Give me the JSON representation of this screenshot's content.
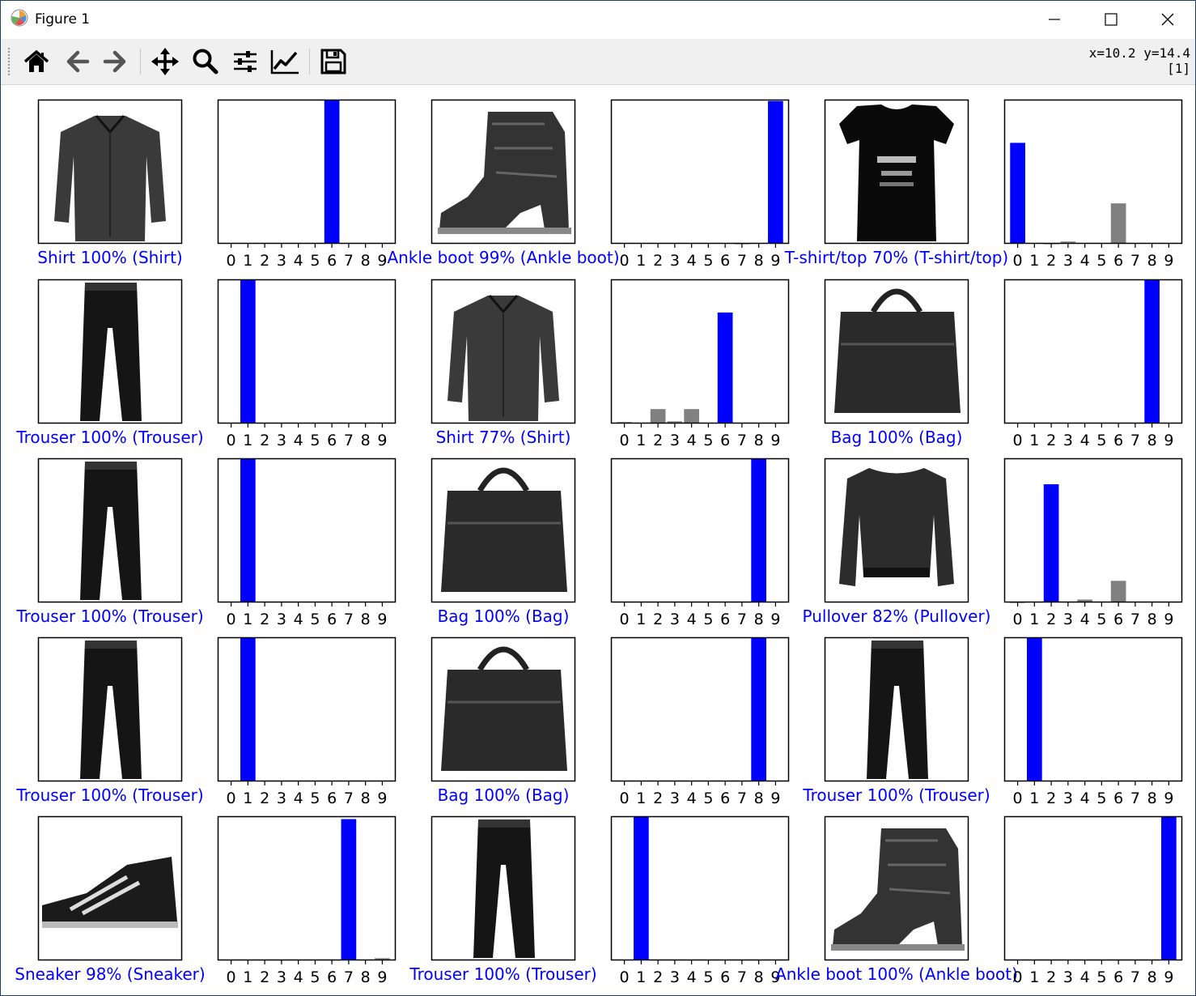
{
  "window": {
    "title": "Figure 1",
    "icon": "matplotlib-icon",
    "controls": [
      "minimize-icon",
      "maximize-icon",
      "close-icon"
    ]
  },
  "toolbar": {
    "tools": [
      {
        "name": "home-icon",
        "tooltip": ""
      },
      {
        "name": "back-arrow-icon"
      },
      {
        "name": "forward-arrow-icon"
      },
      {
        "name": "pan-move-icon"
      },
      {
        "name": "zoom-magnifier-icon"
      },
      {
        "name": "configure-subplots-icon"
      },
      {
        "name": "edit-axis-lines-icon"
      },
      {
        "name": "save-floppy-icon"
      }
    ],
    "coord_readout": "x=10.2 y=14.4",
    "value_readout": "[1]"
  },
  "colors": {
    "predicted_bar": "#0000ff",
    "other_bar": "#808080",
    "label_text": "#0000ff",
    "axes_edge": "#000000"
  },
  "chart_data": {
    "type": "bar",
    "categories": [
      "0",
      "1",
      "2",
      "3",
      "4",
      "5",
      "6",
      "7",
      "8",
      "9"
    ],
    "ylim": [
      0,
      1
    ],
    "grid": false,
    "panels": [
      {
        "image": "shirt-thumbnail",
        "caption": "Shirt 100% (Shirt)",
        "predicted": 6,
        "values": [
          0,
          0,
          0,
          0,
          0,
          0,
          1.0,
          0,
          0,
          0
        ]
      },
      {
        "image": "ankle-boot-thumbnail",
        "caption": "Ankle boot 99% (Ankle boot)",
        "predicted": 9,
        "values": [
          0,
          0,
          0,
          0,
          0,
          0,
          0,
          0.005,
          0,
          0.99
        ]
      },
      {
        "image": "tshirt-top-thumbnail",
        "caption": "T-shirt/top 70% (T-shirt/top)",
        "predicted": 0,
        "values": [
          0.7,
          0,
          0.005,
          0.015,
          0,
          0,
          0.28,
          0,
          0,
          0
        ]
      },
      {
        "image": "trouser-thumbnail",
        "caption": "Trouser 100% (Trouser)",
        "predicted": 1,
        "values": [
          0,
          1.0,
          0,
          0,
          0,
          0,
          0,
          0,
          0,
          0
        ]
      },
      {
        "image": "shirt-thumbnail",
        "caption": "Shirt 77% (Shirt)",
        "predicted": 6,
        "values": [
          0.01,
          0,
          0.1,
          0.015,
          0.1,
          0,
          0.77,
          0,
          0,
          0
        ]
      },
      {
        "image": "bag-thumbnail",
        "caption": "Bag 100% (Bag)",
        "predicted": 8,
        "values": [
          0,
          0,
          0,
          0,
          0,
          0,
          0,
          0,
          1.0,
          0
        ]
      },
      {
        "image": "trouser-thumbnail",
        "caption": "Trouser 100% (Trouser)",
        "predicted": 1,
        "values": [
          0,
          1.0,
          0,
          0,
          0,
          0,
          0,
          0,
          0,
          0
        ]
      },
      {
        "image": "bag-thumbnail",
        "caption": "Bag 100% (Bag)",
        "predicted": 8,
        "values": [
          0,
          0,
          0,
          0,
          0,
          0,
          0,
          0,
          1.0,
          0
        ]
      },
      {
        "image": "pullover-thumbnail",
        "caption": "Pullover 82% (Pullover)",
        "predicted": 2,
        "values": [
          0.005,
          0,
          0.82,
          0,
          0.02,
          0,
          0.15,
          0,
          0,
          0
        ]
      },
      {
        "image": "trouser-thumbnail",
        "caption": "Trouser 100% (Trouser)",
        "predicted": 1,
        "values": [
          0,
          1.0,
          0,
          0,
          0,
          0,
          0,
          0,
          0,
          0
        ]
      },
      {
        "image": "bag-thumbnail",
        "caption": "Bag 100% (Bag)",
        "predicted": 8,
        "values": [
          0,
          0,
          0,
          0,
          0,
          0,
          0,
          0,
          1.0,
          0
        ]
      },
      {
        "image": "trouser-thumbnail",
        "caption": "Trouser 100% (Trouser)",
        "predicted": 1,
        "values": [
          0,
          1.0,
          0,
          0,
          0,
          0,
          0,
          0,
          0,
          0
        ]
      },
      {
        "image": "sneaker-thumbnail",
        "caption": "Sneaker 98% (Sneaker)",
        "predicted": 7,
        "values": [
          0,
          0,
          0,
          0,
          0,
          0,
          0,
          0.98,
          0,
          0.015
        ]
      },
      {
        "image": "trouser-thumbnail",
        "caption": "Trouser 100% (Trouser)",
        "predicted": 1,
        "values": [
          0,
          1.0,
          0,
          0,
          0,
          0,
          0,
          0,
          0,
          0
        ]
      },
      {
        "image": "ankle-boot-thumbnail",
        "caption": "Ankle boot 100% (Ankle boot)",
        "predicted": 9,
        "values": [
          0,
          0,
          0,
          0,
          0,
          0,
          0,
          0,
          0,
          1.0
        ]
      }
    ]
  }
}
